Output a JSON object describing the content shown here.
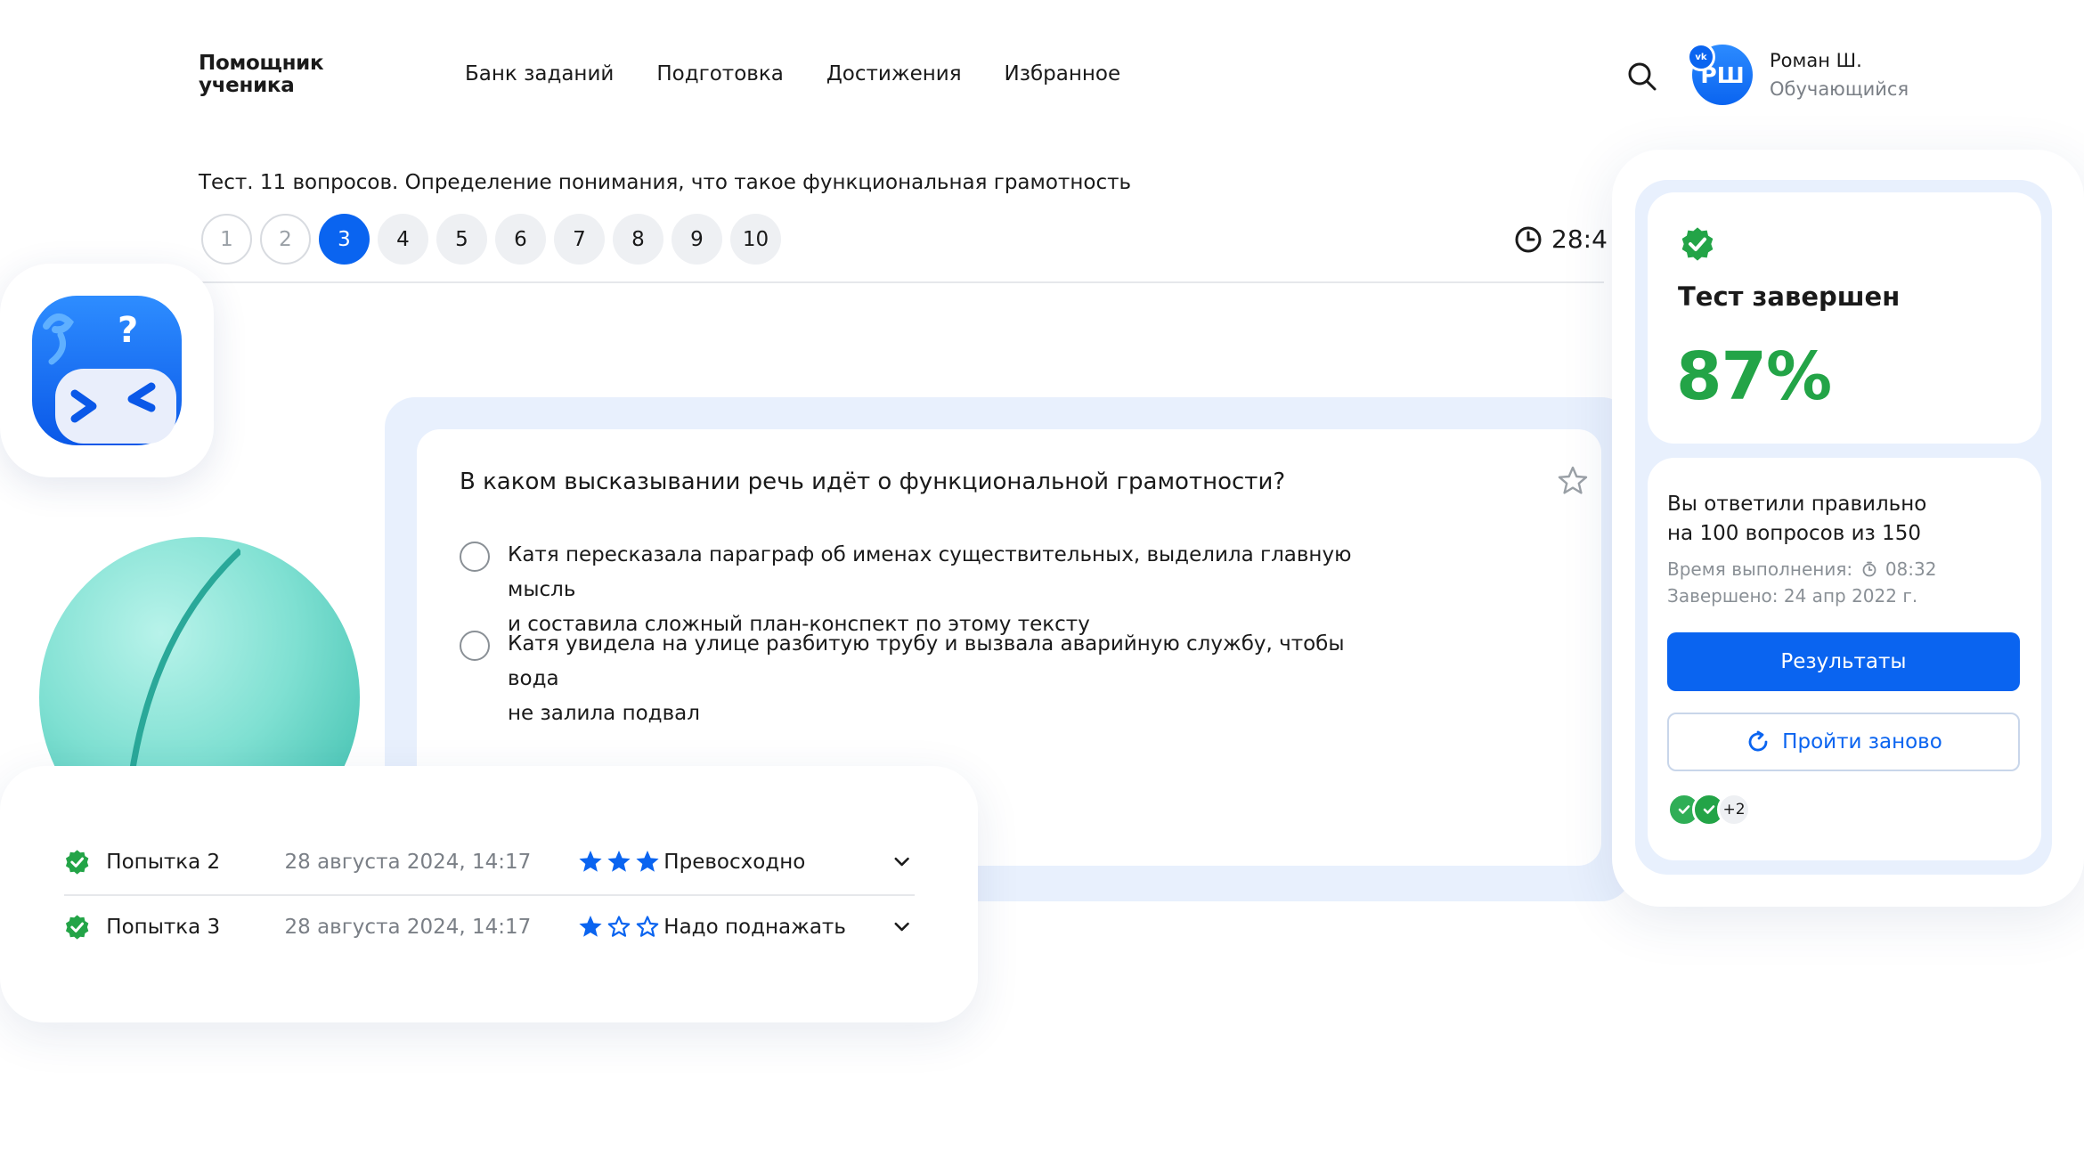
{
  "header": {
    "logo_line1": "Помощник",
    "logo_line2": "ученика",
    "nav": [
      "Банк заданий",
      "Подготовка",
      "Достижения",
      "Избранное"
    ],
    "user": {
      "initials": "РШ",
      "badge": "vk",
      "name": "Роман Ш.",
      "role": "Обучающийся"
    }
  },
  "test": {
    "title": "Тест. 11 вопросов. Определение понимания, что такое функциональная грамотность",
    "pages": [
      "1",
      "2",
      "3",
      "4",
      "5",
      "6",
      "7",
      "8",
      "9",
      "10"
    ],
    "active_page": "3",
    "timer": "28:4"
  },
  "question": {
    "text": "В каком высказывании речь идёт о функциональной грамотности?",
    "options": [
      {
        "line1": "Катя пересказала параграф об именах существительных, выделила главную мысль",
        "line2": "и составила сложный план-конспект по этому тексту"
      },
      {
        "line1": "Катя увидела на улице разбитую трубу и вызвала аварийную службу, чтобы вода",
        "line2": "не залила подвал"
      }
    ]
  },
  "attempts": [
    {
      "label": "Попытка 2",
      "date": "28 августа 2024, 14:17",
      "stars_filled": 3,
      "stars_total": 3,
      "grade": "Превосходно"
    },
    {
      "label": "Попытка 3",
      "date": "28 августа 2024, 14:17",
      "stars_filled": 1,
      "stars_total": 3,
      "grade": "Надо поднажать"
    }
  ],
  "result": {
    "title": "Тест завершен",
    "percent": "87%",
    "answered_line1": "Вы ответили правильно",
    "answered_line2": "на 100 вопросов из 150",
    "time_label": "Время выполнения:",
    "time_value": "08:32",
    "done_label": "Завершено: 24 апр 2022 г.",
    "results_button": "Результаты",
    "retry_button": "Пройти заново",
    "extra_count": "+2"
  },
  "colors": {
    "accent": "#0a64f0",
    "success": "#23a447",
    "muted": "#7a7f86",
    "panel": "#e8f0fd"
  }
}
